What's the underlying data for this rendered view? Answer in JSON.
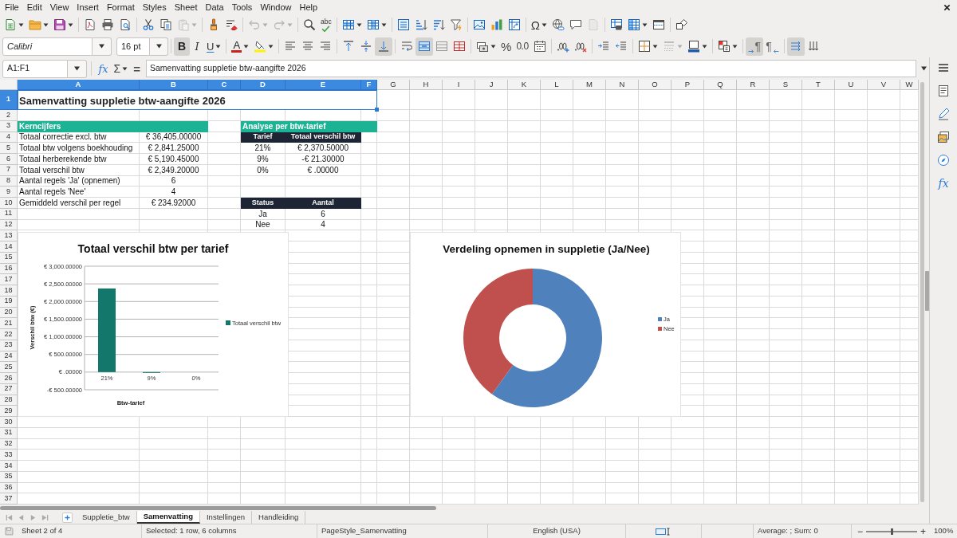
{
  "menu_bar": [
    "File",
    "Edit",
    "View",
    "Insert",
    "Format",
    "Styles",
    "Sheet",
    "Data",
    "Tools",
    "Window",
    "Help"
  ],
  "standard_toolbar": {
    "groups": [
      [
        {
          "kind": "new",
          "dropdown": true,
          "disabled": false
        },
        {
          "kind": "open",
          "dropdown": true,
          "disabled": false
        },
        {
          "kind": "save",
          "dropdown": true,
          "disabled": false
        }
      ],
      [
        {
          "kind": "export_pdf",
          "disabled": false
        },
        {
          "kind": "print",
          "disabled": false
        },
        {
          "kind": "print_preview",
          "disabled": false
        }
      ],
      [
        {
          "kind": "cut",
          "disabled": false
        },
        {
          "kind": "copy",
          "disabled": false
        },
        {
          "kind": "paste",
          "dropdown": true,
          "disabled": true
        }
      ],
      [
        {
          "kind": "clone_formatting",
          "disabled": false
        },
        {
          "kind": "clear_formatting",
          "disabled": false
        }
      ],
      [
        {
          "kind": "undo",
          "dropdown": true,
          "disabled": true
        },
        {
          "kind": "redo",
          "dropdown": true,
          "disabled": true
        }
      ],
      [
        {
          "kind": "find_replace",
          "disabled": false
        },
        {
          "kind": "spelling",
          "glyph": "abc",
          "disabled": false
        }
      ],
      [
        {
          "kind": "rows",
          "dropdown": true,
          "disabled": false
        },
        {
          "kind": "columns",
          "dropdown": true,
          "disabled": false
        }
      ],
      [
        {
          "kind": "sort",
          "disabled": false
        },
        {
          "kind": "sort_ascending",
          "disabled": false
        },
        {
          "kind": "sort_descending",
          "disabled": false
        },
        {
          "kind": "autofilter",
          "disabled": false
        }
      ],
      [
        {
          "kind": "image",
          "disabled": false
        },
        {
          "kind": "chart",
          "disabled": false
        },
        {
          "kind": "pivot_table",
          "disabled": false
        }
      ],
      [
        {
          "kind": "special_character",
          "glyph": "Ω",
          "dropdown": true,
          "disabled": false
        },
        {
          "kind": "hyperlink",
          "disabled": false
        },
        {
          "kind": "comment",
          "disabled": false
        },
        {
          "kind": "header_footer",
          "disabled": true
        }
      ],
      [
        {
          "kind": "print_area",
          "disabled": false
        },
        {
          "kind": "freeze",
          "dropdown": true,
          "disabled": false
        },
        {
          "kind": "split_window",
          "disabled": false
        }
      ],
      [
        {
          "kind": "draw_functions",
          "disabled": false
        }
      ]
    ]
  },
  "formatting_toolbar": {
    "font_name": "Calibri",
    "font_size": "16 pt",
    "groups": [
      [
        {
          "kind": "bold",
          "glyph": "B",
          "pressed": true,
          "disabled": false
        },
        {
          "kind": "italic",
          "glyph": "I",
          "pressed": false,
          "disabled": false
        },
        {
          "kind": "underline",
          "glyph": "U",
          "dropdown": true,
          "pressed": false,
          "disabled": false
        }
      ],
      [
        {
          "kind": "font_color",
          "glyph": "A",
          "dropdown": true,
          "pressed": false,
          "disabled": false
        },
        {
          "kind": "highlight",
          "dropdown": true,
          "pressed": false,
          "disabled": false
        }
      ],
      [
        {
          "kind": "align_left",
          "pressed": false,
          "disabled": false
        },
        {
          "kind": "align_center",
          "pressed": false,
          "disabled": false
        },
        {
          "kind": "align_right",
          "pressed": false,
          "disabled": false
        }
      ],
      [
        {
          "kind": "align_top",
          "pressed": false,
          "disabled": false
        },
        {
          "kind": "align_middle",
          "pressed": false,
          "disabled": false
        },
        {
          "kind": "align_bottom",
          "pressed": true,
          "disabled": false
        }
      ],
      [
        {
          "kind": "wrap",
          "pressed": false,
          "disabled": false
        },
        {
          "kind": "merge_center",
          "pressed": true,
          "disabled": false
        },
        {
          "kind": "merge",
          "pressed": false,
          "disabled": false
        },
        {
          "kind": "unmerge",
          "pressed": false,
          "disabled": false
        }
      ],
      [
        {
          "kind": "currency",
          "dropdown": true,
          "pressed": false,
          "disabled": false
        },
        {
          "kind": "percent",
          "glyph": "%",
          "pressed": false,
          "disabled": false
        },
        {
          "kind": "number",
          "glyph": "0.0",
          "pressed": false,
          "disabled": false
        },
        {
          "kind": "date",
          "pressed": false,
          "disabled": false
        }
      ],
      [
        {
          "kind": "add_decimal",
          "pressed": false,
          "disabled": false
        },
        {
          "kind": "delete_decimal",
          "pressed": false,
          "disabled": false
        }
      ],
      [
        {
          "kind": "indent_increase",
          "pressed": false,
          "disabled": false
        },
        {
          "kind": "indent_decrease",
          "pressed": false,
          "disabled": false
        }
      ],
      [
        {
          "kind": "borders",
          "dropdown": true,
          "pressed": false,
          "disabled": false
        },
        {
          "kind": "border_style",
          "dropdown": true,
          "pressed": false,
          "disabled": true
        },
        {
          "kind": "border_color",
          "dropdown": true,
          "pressed": false,
          "disabled": false
        }
      ],
      [
        {
          "kind": "conditional",
          "dropdown": true,
          "pressed": false,
          "disabled": false
        }
      ],
      [
        {
          "kind": "ltr",
          "glyph": "¶",
          "pressed": true,
          "disabled": false
        },
        {
          "kind": "rtl",
          "glyph": "¶",
          "pressed": false,
          "disabled": false
        }
      ],
      [
        {
          "kind": "text_horizontal",
          "pressed": true,
          "disabled": false
        },
        {
          "kind": "text_vertical",
          "pressed": false,
          "disabled": false
        }
      ]
    ]
  },
  "formula_bar": {
    "name_box": "A1:F1",
    "function_wizard": "fx",
    "sum": "Σ",
    "equals": "=",
    "content": "Samenvatting suppletie btw-aangifte 2026"
  },
  "sheet": {
    "columns": [
      {
        "label": "A",
        "selected": true
      },
      {
        "label": "B",
        "selected": true
      },
      {
        "label": "C",
        "selected": true
      },
      {
        "label": "D",
        "selected": true
      },
      {
        "label": "E",
        "selected": true
      },
      {
        "label": "F",
        "selected": true
      },
      {
        "label": "G",
        "selected": false
      },
      {
        "label": "H",
        "selected": false
      },
      {
        "label": "I",
        "selected": false
      },
      {
        "label": "J",
        "selected": false
      },
      {
        "label": "K",
        "selected": false
      },
      {
        "label": "L",
        "selected": false
      },
      {
        "label": "M",
        "selected": false
      },
      {
        "label": "N",
        "selected": false
      },
      {
        "label": "O",
        "selected": false
      },
      {
        "label": "P",
        "selected": false
      },
      {
        "label": "Q",
        "selected": false
      },
      {
        "label": "R",
        "selected": false
      },
      {
        "label": "S",
        "selected": false
      },
      {
        "label": "T",
        "selected": false
      },
      {
        "label": "U",
        "selected": false
      },
      {
        "label": "V",
        "selected": false
      },
      {
        "label": "W",
        "selected": false
      }
    ],
    "rows": [
      {
        "label": "1",
        "selected": true
      },
      {
        "label": "2",
        "selected": false
      },
      {
        "label": "3",
        "selected": false
      },
      {
        "label": "4",
        "selected": false
      },
      {
        "label": "5",
        "selected": false
      },
      {
        "label": "6",
        "selected": false
      },
      {
        "label": "7",
        "selected": false
      },
      {
        "label": "8",
        "selected": false
      },
      {
        "label": "9",
        "selected": false
      },
      {
        "label": "10",
        "selected": false
      },
      {
        "label": "11",
        "selected": false
      },
      {
        "label": "12",
        "selected": false
      },
      {
        "label": "13",
        "selected": false
      },
      {
        "label": "14",
        "selected": false
      },
      {
        "label": "15",
        "selected": false
      },
      {
        "label": "16",
        "selected": false
      },
      {
        "label": "17",
        "selected": false
      },
      {
        "label": "18",
        "selected": false
      },
      {
        "label": "19",
        "selected": false
      },
      {
        "label": "20",
        "selected": false
      },
      {
        "label": "21",
        "selected": false
      },
      {
        "label": "22",
        "selected": false
      },
      {
        "label": "23",
        "selected": false
      },
      {
        "label": "24",
        "selected": false
      },
      {
        "label": "25",
        "selected": false
      },
      {
        "label": "26",
        "selected": false
      },
      {
        "label": "27",
        "selected": false
      },
      {
        "label": "28",
        "selected": false
      },
      {
        "label": "29",
        "selected": false
      },
      {
        "label": "30",
        "selected": false
      },
      {
        "label": "31",
        "selected": false
      },
      {
        "label": "32",
        "selected": false
      },
      {
        "label": "33",
        "selected": false
      },
      {
        "label": "34",
        "selected": false
      },
      {
        "label": "35",
        "selected": false
      },
      {
        "label": "36",
        "selected": false
      },
      {
        "label": "37",
        "selected": false
      }
    ],
    "title": "Samenvatting suppletie btw-aangifte 2026",
    "key_figures": {
      "heading": "Kerncijfers",
      "rows": [
        {
          "label": "Totaal correctie excl. btw",
          "value": "€ 36,405.00000"
        },
        {
          "label": "Totaal btw volgens boekhouding",
          "value": "€ 2,841.25000"
        },
        {
          "label": "Totaal herberekende btw",
          "value": "€ 5,190.45000"
        },
        {
          "label": "Totaal verschil btw",
          "value": "€ 2,349.20000"
        },
        {
          "label": "Aantal regels 'Ja' (opnemen)",
          "value": "6"
        },
        {
          "label": "Aantal regels 'Nee'",
          "value": "4"
        },
        {
          "label": "Gemiddeld verschil per regel",
          "value": "€ 234.92000"
        }
      ]
    },
    "rate_analysis": {
      "heading": "Analyse per btw-tarief",
      "columns": [
        "Tarief",
        "Totaal verschil btw"
      ],
      "rows": [
        {
          "cells": [
            "21%",
            "€ 2,370.50000"
          ]
        },
        {
          "cells": [
            "9%",
            "-€ 21.30000"
          ]
        },
        {
          "cells": [
            "0%",
            "€ .00000"
          ]
        }
      ]
    },
    "status_count": {
      "columns": [
        "Status",
        "Aantal"
      ],
      "rows": [
        {
          "cells": [
            "Ja",
            "6"
          ]
        },
        {
          "cells": [
            "Nee",
            "4"
          ]
        }
      ]
    }
  },
  "charts": [
    {
      "chart_data": {
        "type": "bar",
        "title": "Totaal verschil btw per tarief",
        "xlabel": "Btw-tarief",
        "ylabel": "Verschil btw (€)",
        "categories": [
          "21%",
          "9%",
          "0%"
        ],
        "series": [
          {
            "name": "Totaal verschil btw",
            "color": "#13786b",
            "values": [
              2370,
              -20,
              0
            ]
          }
        ],
        "ylim": [
          -500,
          3000
        ],
        "yticks": [
          {
            "value": -500,
            "label": "-€ 500.00000"
          },
          {
            "value": 0,
            "label": "€ .00000"
          },
          {
            "value": 500,
            "label": "€ 500.00000"
          },
          {
            "value": 1000,
            "label": "€ 1,000.00000"
          },
          {
            "value": 1500,
            "label": "€ 1,500.00000"
          },
          {
            "value": 2000,
            "label": "€ 2,000.00000"
          },
          {
            "value": 2500,
            "label": "€ 2,500.00000"
          },
          {
            "value": 3000,
            "label": "€ 3,000.00000"
          }
        ],
        "grid": true,
        "legend": "right"
      }
    },
    {
      "chart_data": {
        "type": "donut",
        "title": "Verdeling opnemen in suppletie (Ja/Nee)",
        "categories": [
          "Ja",
          "Nee"
        ],
        "series": [
          {
            "values": [
              60,
              40
            ]
          }
        ],
        "legend": "right"
      }
    }
  ],
  "sheet_tabs": [
    {
      "label": "Suppletie_btw",
      "selected": false
    },
    {
      "label": "Samenvatting",
      "selected": true
    },
    {
      "label": "Instellingen",
      "selected": false
    },
    {
      "label": "Handleiding",
      "selected": false
    }
  ],
  "sidebar": [
    {
      "kind": "menu"
    },
    {
      "kind": "properties"
    },
    {
      "kind": "styles"
    },
    {
      "kind": "gallery"
    },
    {
      "kind": "navigator"
    },
    {
      "kind": "functions",
      "glyph": "fx"
    }
  ],
  "status_bar": {
    "sheet_position": "Sheet 2 of 4",
    "selection": "Selected: 1 row, 6 columns",
    "page_style": "PageStyle_Samenvatting",
    "language": "English (USA)",
    "summary": "Average: ; Sum: 0",
    "zoom": {
      "minus": "−",
      "level": 0.5,
      "plus": "+",
      "reading": "100%"
    }
  }
}
